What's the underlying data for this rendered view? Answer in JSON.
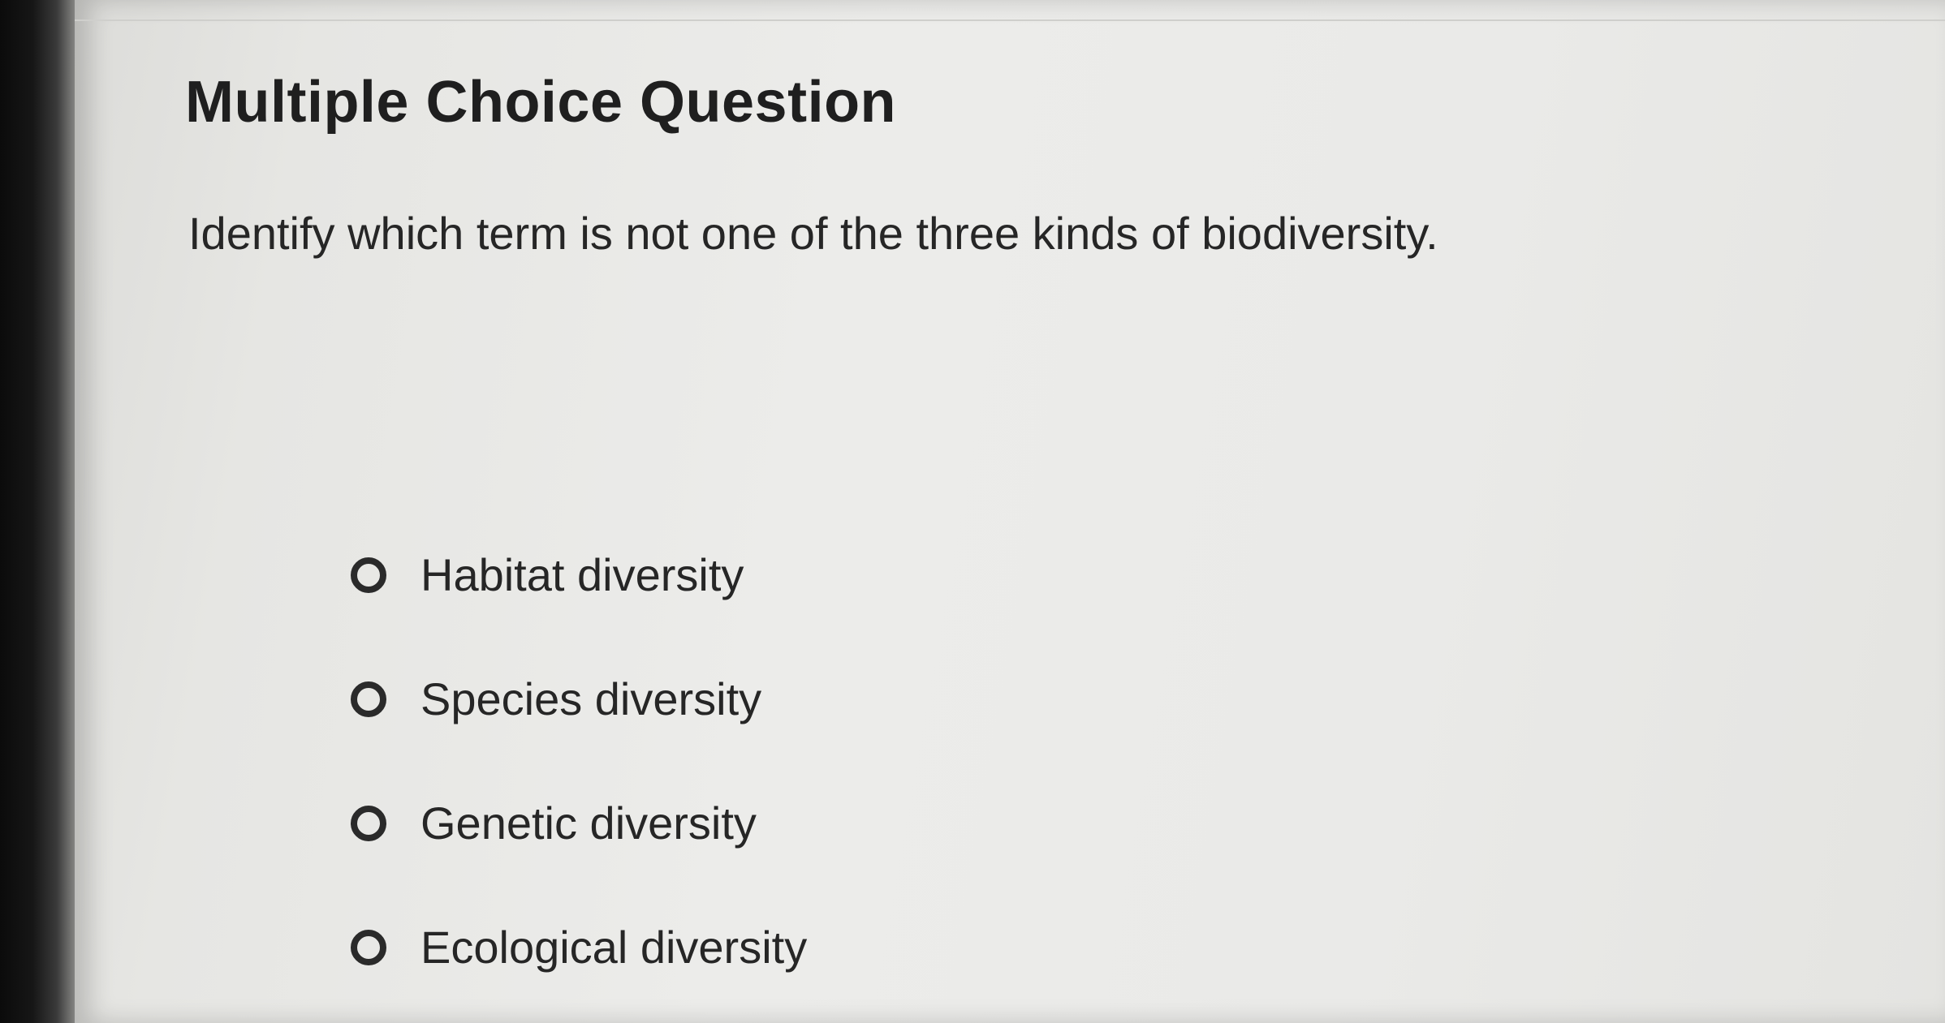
{
  "title": "Multiple Choice Question",
  "question": "Identify which term is not one of the three kinds of biodiversity.",
  "options": [
    {
      "label": "Habitat diversity",
      "selected": false
    },
    {
      "label": "Species diversity",
      "selected": false
    },
    {
      "label": "Genetic diversity",
      "selected": false
    },
    {
      "label": "Ecological diversity",
      "selected": false
    }
  ]
}
